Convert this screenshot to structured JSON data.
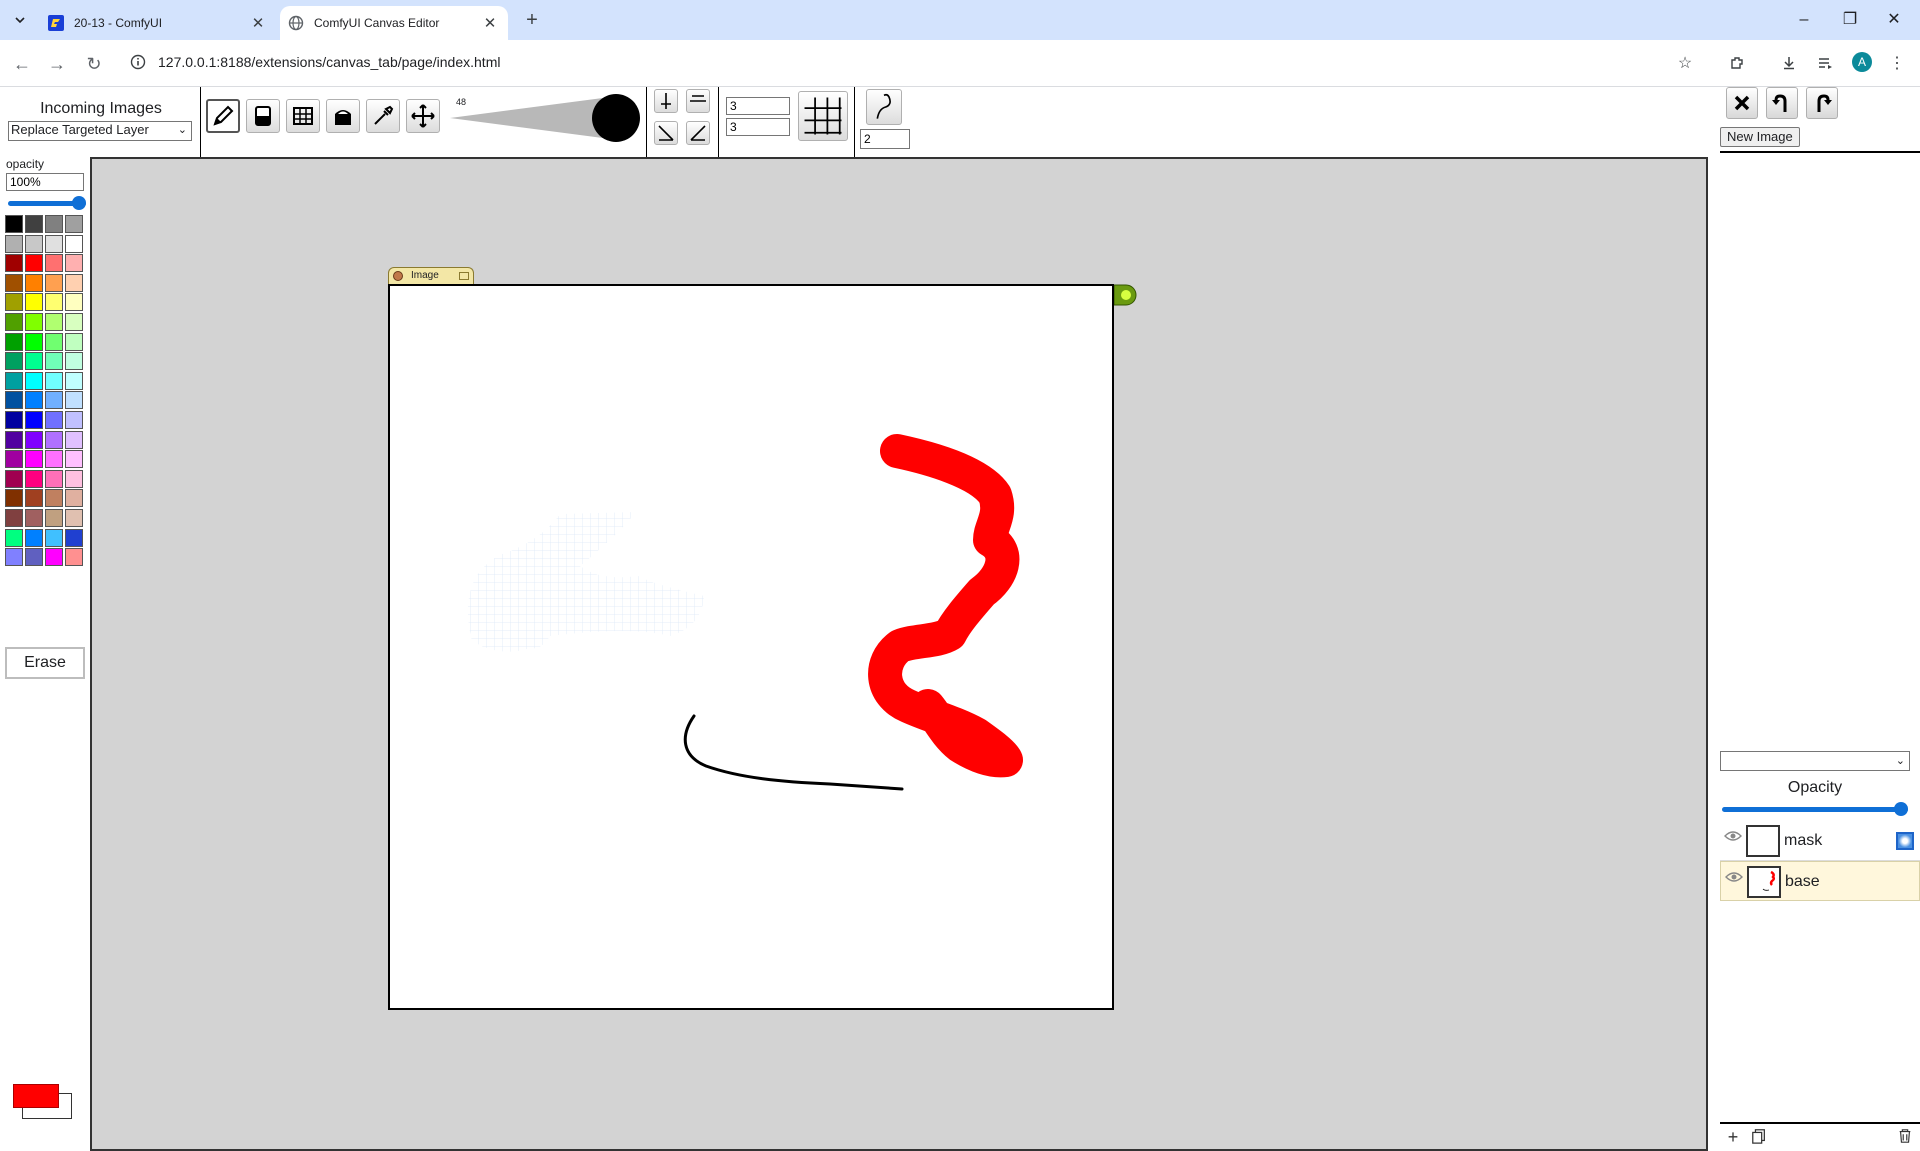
{
  "browser": {
    "tabs": [
      {
        "title": "20-13 - ComfyUI",
        "active": false,
        "icon": "comfyui-icon"
      },
      {
        "title": "ComfyUI Canvas Editor",
        "active": true,
        "icon": "globe-icon"
      }
    ],
    "url": "127.0.0.1:8188/extensions/canvas_tab/page/index.html",
    "profile_initial": "A"
  },
  "toolbar": {
    "incoming_title": "Incoming Images",
    "incoming_mode": "Replace Targeted Layer",
    "brush_size": "48",
    "tools": [
      "pencil-icon",
      "eraser-icon",
      "grid-select-icon",
      "fill-bucket-icon",
      "eyedropper-icon",
      "move-icon"
    ],
    "active_tool": "pencil-icon",
    "grid_cols": "3",
    "grid_rows": "3",
    "curve_value": "2"
  },
  "left_panel": {
    "opacity_label": "opacity",
    "opacity_value": "100%",
    "opacity_level": 1.0,
    "erase_label": "Erase",
    "foreground_color": "#ff0000",
    "background_color": "#ffffff",
    "palette": [
      [
        "#000000",
        "#404040",
        "#808080",
        "#a0a0a0"
      ],
      [
        "#b0b0b0",
        "#c8c8c8",
        "#e0e0e0",
        "#ffffff"
      ],
      [
        "#a00000",
        "#ff0000",
        "#ff7070",
        "#ffb0b0"
      ],
      [
        "#a05000",
        "#ff8000",
        "#ffa050",
        "#ffd0b0"
      ],
      [
        "#a0a000",
        "#ffff00",
        "#ffff70",
        "#ffffc0"
      ],
      [
        "#50a000",
        "#80ff00",
        "#b0ff70",
        "#d8ffc0"
      ],
      [
        "#00a000",
        "#00ff00",
        "#70ff70",
        "#c0ffc0"
      ],
      [
        "#00a060",
        "#00ff90",
        "#70ffb8",
        "#c0ffe0"
      ],
      [
        "#00a0a0",
        "#00ffff",
        "#70ffff",
        "#c0ffff"
      ],
      [
        "#0050a0",
        "#0080ff",
        "#70b0ff",
        "#c0e0ff"
      ],
      [
        "#0000a0",
        "#0000ff",
        "#7070ff",
        "#c0c0ff"
      ],
      [
        "#5000a0",
        "#8000ff",
        "#b070ff",
        "#e0c0ff"
      ],
      [
        "#a000a0",
        "#ff00ff",
        "#ff70ff",
        "#ffc0ff"
      ],
      [
        "#a00050",
        "#ff0080",
        "#ff70b8",
        "#ffc0e0"
      ],
      [
        "#803000",
        "#a04020",
        "#c08060",
        "#e0b0a0"
      ],
      [
        "#804040",
        "#a06060",
        "#c0a080",
        "#e0c0b0"
      ],
      [
        "#00ff80",
        "#0080ff",
        "#40c0ff",
        "#2040d0"
      ],
      [
        "#8080ff",
        "#6060c0",
        "#ff00ff",
        "#ff9090"
      ]
    ]
  },
  "canvas": {
    "node_title": "Image",
    "background": "#d3d3d3"
  },
  "right_panel": {
    "new_image_label": "New Image",
    "opacity_label": "Opacity",
    "opacity_level": 1.0,
    "layers": [
      {
        "name": "mask",
        "visible": true,
        "selected": false,
        "is_mask": true
      },
      {
        "name": "base",
        "visible": true,
        "selected": true,
        "is_mask": false
      }
    ]
  }
}
